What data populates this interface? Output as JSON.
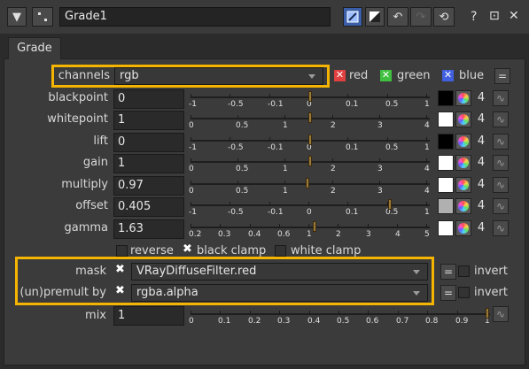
{
  "node": {
    "name": "Grade1",
    "tab": "Grade",
    "title_icon": "wrench-icon",
    "toolbar_icons": [
      "view-mode-icon",
      "compare-icon",
      "undo-icon",
      "redo-icon",
      "revert-icon",
      "help-icon",
      "float-icon",
      "close-icon"
    ],
    "help": "?",
    "float": "⊡",
    "close": "✕"
  },
  "channels": {
    "label": "channels",
    "value": "rgb",
    "options": [
      {
        "label": "red",
        "color": "#e04040"
      },
      {
        "label": "green",
        "color": "#40c040"
      },
      {
        "label": "blue",
        "color": "#4060e0"
      }
    ],
    "eq_label": "="
  },
  "rows": [
    {
      "key": "blackpoint",
      "label": "blackpoint",
      "value": "0",
      "swatch": "#000000",
      "count": "4",
      "scale": [
        "-1",
        "-0.5",
        "-0.1",
        "0",
        "0.1",
        "0.5",
        "1"
      ]
    },
    {
      "key": "whitepoint",
      "label": "whitepoint",
      "value": "1",
      "swatch": "#ffffff",
      "count": "4",
      "scale": [
        "0",
        "0.5",
        "1",
        "2",
        "3",
        "4"
      ]
    },
    {
      "key": "lift",
      "label": "lift",
      "value": "0",
      "swatch": "#000000",
      "count": "4",
      "scale": [
        "-1",
        "-0.5",
        "-0.1",
        "0",
        "0.1",
        "0.5",
        "1"
      ]
    },
    {
      "key": "gain",
      "label": "gain",
      "value": "1",
      "swatch": "#ffffff",
      "count": "4",
      "scale": [
        "0",
        "0.5",
        "1",
        "2",
        "3",
        "4"
      ]
    },
    {
      "key": "multiply",
      "label": "multiply",
      "value": "0.97",
      "swatch": "#ffffff",
      "count": "4",
      "scale": [
        "0",
        "0.5",
        "1",
        "2",
        "3",
        "4"
      ]
    },
    {
      "key": "offset",
      "label": "offset",
      "value": "0.405",
      "swatch": "#b0b0b0",
      "count": "4",
      "scale": [
        "-1",
        "-0.5",
        "-0.1",
        "0",
        "0.1",
        "0.5",
        "1"
      ]
    },
    {
      "key": "gamma",
      "label": "gamma",
      "value": "1.63",
      "swatch": "#ffffff",
      "count": "4",
      "scale": [
        "0.2",
        "0.3",
        "0.4",
        "0.6",
        "1",
        "2",
        "3",
        "4",
        "5"
      ]
    }
  ],
  "clamp": {
    "reverse": "reverse",
    "black_clamp": "black clamp",
    "white_clamp": "white clamp"
  },
  "mask": {
    "label": "mask",
    "value": "VRayDiffuseFilter.red",
    "eq_label": "=",
    "invert": "invert"
  },
  "premult": {
    "label": "(un)premult by",
    "value": "rgba.alpha",
    "eq_label": "=",
    "invert": "invert"
  },
  "mix": {
    "label": "mix",
    "value": "1",
    "count_ticks": [
      "0",
      "0.1",
      "0.2",
      "0.3",
      "0.4",
      "0.5",
      "0.6",
      "0.7",
      "0.8",
      "0.9",
      "1"
    ]
  },
  "colors": {
    "highlight": "#f4b400",
    "handle": "#9b7a35"
  }
}
